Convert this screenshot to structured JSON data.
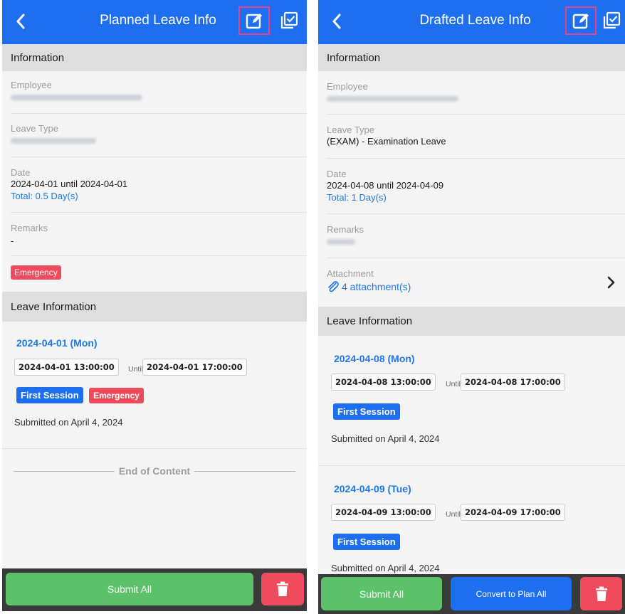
{
  "left": {
    "title": "Planned Leave Info",
    "information_header": "Information",
    "employee_label": "Employee",
    "leave_type_label": "Leave Type",
    "date_label": "Date",
    "date_value": "2024-04-01 until 2024-04-01",
    "total": "Total: 0.5 Day(s)",
    "remarks_label": "Remarks",
    "remarks_value": "-",
    "emergency_tag": "Emergency",
    "leave_info_header": "Leave Information",
    "entries": [
      {
        "day": "2024-04-01 (Mon)",
        "from": "2024-04-01 13:00:00",
        "until": "Until",
        "to": "2024-04-01 17:00:00",
        "session": "First Session",
        "tag": "Emergency",
        "submitted": "Submitted on April 4, 2024"
      }
    ],
    "end_of_content": "End of Content",
    "submit_all": "Submit All"
  },
  "right": {
    "title": "Drafted Leave Info",
    "information_header": "Information",
    "employee_label": "Employee",
    "leave_type_label": "Leave Type",
    "leave_type_value": "(EXAM) - Examination Leave",
    "date_label": "Date",
    "date_value": "2024-04-08 until 2024-04-09",
    "total": "Total: 1 Day(s)",
    "remarks_label": "Remarks",
    "attachment_label": "Attachment",
    "attachment_value": "4 attachment(s)",
    "leave_info_header": "Leave Information",
    "entries": [
      {
        "day": "2024-04-08 (Mon)",
        "from": "2024-04-08 13:00:00",
        "until": "Until",
        "to": "2024-04-08 17:00:00",
        "session": "First Session",
        "submitted": "Submitted on April 4, 2024"
      },
      {
        "day": "2024-04-09 (Tue)",
        "from": "2024-04-09 13:00:00",
        "until": "Until",
        "to": "2024-04-09 17:00:00",
        "session": "First Session",
        "submitted": "Submitted on April 4, 2024"
      }
    ],
    "submit_all": "Submit All",
    "convert_all": "Convert to Plan All"
  },
  "colors": {
    "appbar": "#1e6ef0",
    "highlight": "#e83e8c",
    "link": "#1f78e6",
    "emergency": "#ef4b5c",
    "submit": "#5cc26a",
    "delete": "#ef4b5c"
  },
  "icons": [
    "back-chevron-icon",
    "edit-icon",
    "check-list-icon",
    "paperclip-icon",
    "chevron-right-icon",
    "trash-icon"
  ]
}
